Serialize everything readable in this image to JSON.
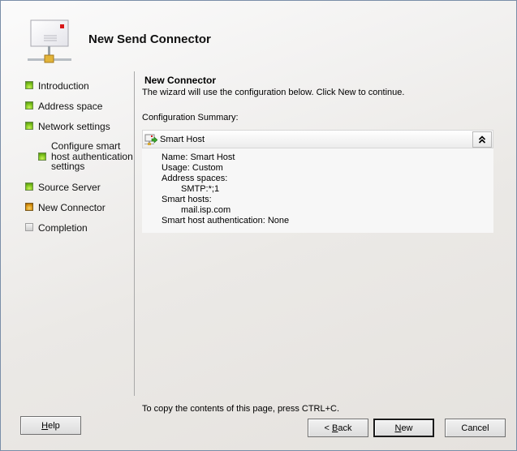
{
  "wizard": {
    "title": "New Send Connector",
    "header_icon": "envelope-network-icon"
  },
  "nav": {
    "items": [
      {
        "label": "Introduction",
        "state": "done"
      },
      {
        "label": "Address space",
        "state": "done"
      },
      {
        "label": "Network settings",
        "state": "done"
      },
      {
        "label": "Configure smart host authentication settings",
        "lines": [
          "Configure smart",
          "host authentication",
          "settings"
        ],
        "state": "done",
        "sub": true
      },
      {
        "label": "Source Server",
        "state": "done"
      },
      {
        "label": "New Connector",
        "state": "current"
      },
      {
        "label": "Completion",
        "state": "pending"
      }
    ]
  },
  "page": {
    "heading": "New Connector",
    "description": "The wizard will use the configuration below.  Click New to continue.",
    "summary_label": "Configuration Summary:",
    "copy_hint": "To copy the contents of this page, press CTRL+C."
  },
  "summary_panel": {
    "title": "Smart Host",
    "icon": "smart-host-connector-icon",
    "collapse_glyph": "˄",
    "lines": [
      {
        "text": "Name: Smart Host",
        "indent": false
      },
      {
        "text": "Usage: Custom",
        "indent": false
      },
      {
        "text": "Address spaces:",
        "indent": false
      },
      {
        "text": "SMTP:*;1",
        "indent": true
      },
      {
        "text": "Smart hosts:",
        "indent": false
      },
      {
        "text": "mail.isp.com",
        "indent": true
      },
      {
        "text": "Smart host authentication: None",
        "indent": false
      }
    ]
  },
  "buttons": {
    "help": {
      "prefix": "",
      "accel": "H",
      "rest": "elp"
    },
    "back": {
      "prefix": "< ",
      "accel": "B",
      "rest": "ack"
    },
    "new": {
      "prefix": "",
      "accel": "N",
      "rest": "ew"
    },
    "cancel": {
      "prefix": "",
      "accel": "",
      "rest": "Cancel"
    }
  }
}
